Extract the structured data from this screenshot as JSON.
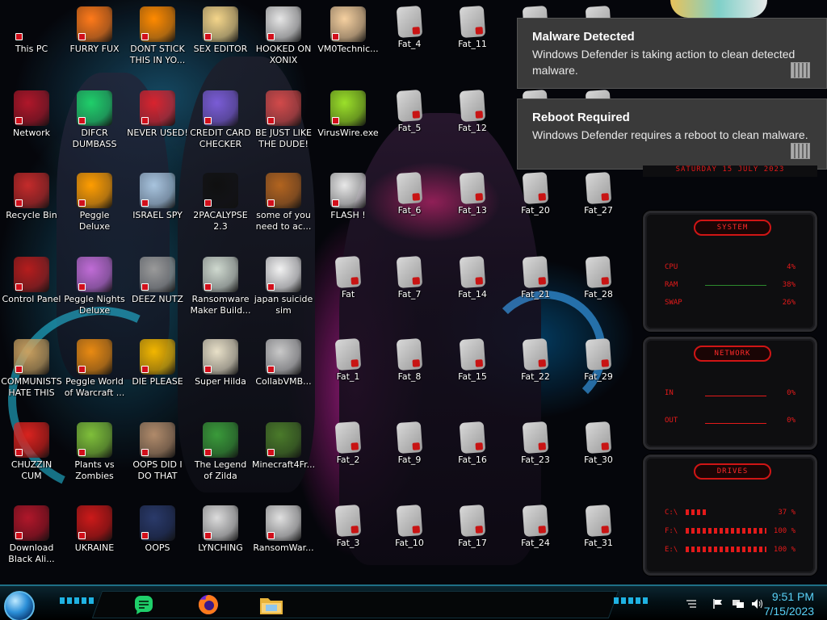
{
  "desktop": {
    "icons": [
      {
        "id": "this-pc",
        "label": "This PC",
        "glyph": "pc-icon",
        "color": "#333"
      },
      {
        "id": "furry-fux",
        "label": "FURRY FUX",
        "glyph": "firefox-icon",
        "color": "#ff7a1a"
      },
      {
        "id": "dont-stick",
        "label": "DONT STICK THIS IN YO...",
        "glyph": "vlc-icon",
        "color": "#ff8a00"
      },
      {
        "id": "sex-editor",
        "label": "SEX EDITOR",
        "glyph": "hxd-icon",
        "color": "#f4d58a"
      },
      {
        "id": "hooked-on-xonix",
        "label": "HOOKED ON XONIX",
        "glyph": "xonix-icon",
        "color": "#e6e6e6"
      },
      {
        "id": "vm0technic",
        "label": "VM0Technic...",
        "glyph": "doctor-icon",
        "color": "#f5d0a0"
      },
      {
        "id": "fat-4",
        "label": "Fat_4",
        "glyph": "folder-icon"
      },
      {
        "id": "fat-11",
        "label": "Fat_11",
        "glyph": "folder-icon"
      },
      {
        "id": "network",
        "label": "Network",
        "glyph": "network-icon",
        "color": "#b0172a"
      },
      {
        "id": "diabolical",
        "label": "DIFCR DUMBASS",
        "glyph": "chat-icon",
        "color": "#1fcf6a"
      },
      {
        "id": "never-used",
        "label": "NEVER USED!",
        "glyph": "devcpp-icon",
        "color": "#d9232e"
      },
      {
        "id": "credit-card",
        "label": "CREDIT CARD CHECKER",
        "glyph": "card-icon",
        "color": "#7a5cd6"
      },
      {
        "id": "be-just",
        "label": "BE JUST LIKE THE DUDE!",
        "glyph": "santa-icon",
        "color": "#d24a4a"
      },
      {
        "id": "viruswire",
        "label": "VirusWire.exe",
        "glyph": "lime-icon",
        "color": "#9be02a"
      },
      {
        "id": "fat-5",
        "label": "Fat_5",
        "glyph": "folder-icon"
      },
      {
        "id": "fat-12",
        "label": "Fat_12",
        "glyph": "folder-icon"
      },
      {
        "id": "recycle-bin",
        "label": "Recycle Bin",
        "glyph": "trash-icon",
        "color": "#c42b2b"
      },
      {
        "id": "peggle-deluxe",
        "label": "Peggle Deluxe",
        "glyph": "peggle-icon",
        "color": "#ff9d00"
      },
      {
        "id": "israel-spy",
        "label": "ISRAEL SPY",
        "glyph": "spy-icon",
        "color": "#a8c4de"
      },
      {
        "id": "2pacalypse",
        "label": "2PACALYPSE 2.3",
        "glyph": "terminal-icon",
        "color": "#101010"
      },
      {
        "id": "some-of-you",
        "label": "some of you need to ac...",
        "glyph": "dog-icon",
        "color": "#b2641f"
      },
      {
        "id": "flash",
        "label": "FLASH !",
        "glyph": "flash-icon",
        "color": "#e8e8e8"
      },
      {
        "id": "fat-6",
        "label": "Fat_6",
        "glyph": "folder-icon"
      },
      {
        "id": "fat-13",
        "label": "Fat_13",
        "glyph": "folder-icon"
      },
      {
        "id": "fat-20",
        "label": "Fat_20",
        "glyph": "folder-icon"
      },
      {
        "id": "fat-27",
        "label": "Fat_27",
        "glyph": "folder-icon"
      },
      {
        "id": "control-panel",
        "label": "Control Panel",
        "glyph": "control-panel-icon",
        "color": "#b51d1d"
      },
      {
        "id": "peggle-nights",
        "label": "Peggle Nights Deluxe",
        "glyph": "peggle-icon",
        "color": "#c06cd6"
      },
      {
        "id": "deez-nutz",
        "label": "DEEZ NUTZ",
        "glyph": "stack-icon",
        "color": "#9a9a9a"
      },
      {
        "id": "ransomware-maker",
        "label": "Ransomware Maker Build...",
        "glyph": "window-icon",
        "color": "#cfd9cf"
      },
      {
        "id": "japan-suicide",
        "label": "japan suicide sim",
        "glyph": "doc-icon",
        "color": "#f2f2f2"
      },
      {
        "id": "fat",
        "label": "Fat",
        "glyph": "folder-icon"
      },
      {
        "id": "fat-7",
        "label": "Fat_7",
        "glyph": "folder-icon"
      },
      {
        "id": "fat-14",
        "label": "Fat_14",
        "glyph": "folder-icon"
      },
      {
        "id": "fat-21",
        "label": "Fat_21",
        "glyph": "folder-icon"
      },
      {
        "id": "fat-28",
        "label": "Fat_28",
        "glyph": "folder-icon"
      },
      {
        "id": "communists",
        "label": "COMMUNISTS HATE THIS G...",
        "glyph": "money-bag-icon",
        "color": "#c9a060"
      },
      {
        "id": "peggle-world",
        "label": "Peggle World of Warcraft ...",
        "glyph": "peggle-icon",
        "color": "#e98a12"
      },
      {
        "id": "die-please",
        "label": "DIE PLEASE",
        "glyph": "de-icon",
        "color": "#f2b600"
      },
      {
        "id": "super-hilda",
        "label": "Super Hilda",
        "glyph": "pixel-icon",
        "color": "#e8e0c8"
      },
      {
        "id": "collabvmb",
        "label": "CollabVMB...",
        "glyph": "collab-icon",
        "color": "#c9c9c9"
      },
      {
        "id": "fat-1",
        "label": "Fat_1",
        "glyph": "folder-icon"
      },
      {
        "id": "fat-8",
        "label": "Fat_8",
        "glyph": "folder-icon"
      },
      {
        "id": "fat-15",
        "label": "Fat_15",
        "glyph": "folder-icon"
      },
      {
        "id": "fat-22",
        "label": "Fat_22",
        "glyph": "folder-icon"
      },
      {
        "id": "fat-29",
        "label": "Fat_29",
        "glyph": "folder-icon"
      },
      {
        "id": "chuzzin-cum",
        "label": "CHUZZIN CUM",
        "glyph": "chuzzle-icon",
        "color": "#d9231f"
      },
      {
        "id": "plants-vs-zombies",
        "label": "Plants vs Zombies",
        "glyph": "plant-icon",
        "color": "#7fbf3a"
      },
      {
        "id": "oops-did",
        "label": "OOPS DID I DO THAT",
        "glyph": "portrait-icon",
        "color": "#b08a6a"
      },
      {
        "id": "legend-of-zilda",
        "label": "The Legend of Zilda",
        "glyph": "zelda-icon",
        "color": "#3a9a3a"
      },
      {
        "id": "minecraft",
        "label": "Minecraft4Fr...",
        "glyph": "minecraft-icon",
        "color": "#4a7a2a"
      },
      {
        "id": "fat-2",
        "label": "Fat_2",
        "glyph": "folder-icon"
      },
      {
        "id": "fat-9",
        "label": "Fat_9",
        "glyph": "folder-icon"
      },
      {
        "id": "fat-16",
        "label": "Fat_16",
        "glyph": "folder-icon"
      },
      {
        "id": "fat-23",
        "label": "Fat_23",
        "glyph": "folder-icon"
      },
      {
        "id": "fat-30",
        "label": "Fat_30",
        "glyph": "folder-icon"
      },
      {
        "id": "download-black",
        "label": "Download Black Ali...",
        "glyph": "network-icon",
        "color": "#b0172a"
      },
      {
        "id": "ukraine",
        "label": "UKRAINE",
        "glyph": "radiation-icon",
        "color": "#cc1a1a"
      },
      {
        "id": "oops",
        "label": "OOPS",
        "glyph": "book-icon",
        "color": "#2a3a6a"
      },
      {
        "id": "lynching",
        "label": "LYNCHING",
        "glyph": "noose-icon",
        "color": "#dcdcdc"
      },
      {
        "id": "ransomwar",
        "label": "RansomWar...",
        "glyph": "skull-icon",
        "color": "#e0e0e0"
      },
      {
        "id": "fat-3",
        "label": "Fat_3",
        "glyph": "folder-icon"
      },
      {
        "id": "fat-10",
        "label": "Fat_10",
        "glyph": "folder-icon"
      },
      {
        "id": "fat-17",
        "label": "Fat_17",
        "glyph": "folder-icon"
      },
      {
        "id": "fat-24",
        "label": "Fat_24",
        "glyph": "folder-icon"
      },
      {
        "id": "fat-31",
        "label": "Fat_31",
        "glyph": "folder-icon"
      },
      {
        "id": "fat-18",
        "label": "",
        "glyph": "folder-icon"
      },
      {
        "id": "fat-19",
        "label": "",
        "glyph": "folder-icon"
      },
      {
        "id": "fat-25",
        "label": "",
        "glyph": "folder-icon"
      },
      {
        "id": "fat-26",
        "label": "",
        "glyph": "folder-icon"
      }
    ]
  },
  "notifications": [
    {
      "title": "Malware Detected",
      "body": "Windows Defender is taking action to clean detected malware.",
      "icon": "defender-icon"
    },
    {
      "title": "Reboot Required",
      "body": "Windows Defender requires a reboot to clean malware.",
      "icon": "defender-icon"
    }
  ],
  "widget": {
    "date_strip": "SATURDAY 15 JULY 2023",
    "system": {
      "title": "SYSTEM",
      "rows": [
        {
          "label": "CPU",
          "value": "4%"
        },
        {
          "label": "RAM",
          "value": "38%"
        },
        {
          "label": "SWAP",
          "value": "26%"
        }
      ]
    },
    "network": {
      "title": "NETWORK",
      "rows": [
        {
          "label": "IN",
          "value": "0%"
        },
        {
          "label": "OUT",
          "value": "0%"
        }
      ]
    },
    "drives": {
      "title": "DRIVES",
      "rows": [
        {
          "label": "C:\\",
          "value": "37 %"
        },
        {
          "label": "F:\\",
          "value": "100 %"
        },
        {
          "label": "E:\\",
          "value": "100 %"
        }
      ]
    },
    "accent": "#e41a1a"
  },
  "taskbar": {
    "start_icon": "start-orb-icon",
    "apps": [
      {
        "id": "chat",
        "icon": "chat-icon",
        "color": "#1fcf6a"
      },
      {
        "id": "firefox",
        "icon": "firefox-icon",
        "color": "#ff7a1a"
      },
      {
        "id": "explorer",
        "icon": "folder-icon",
        "color": "#f2c14a"
      }
    ],
    "tray": [
      "flag-icon",
      "network-icon",
      "volume-icon"
    ],
    "time": "9:51 PM",
    "date": "7/15/2023",
    "accent": "#59d1f7"
  }
}
